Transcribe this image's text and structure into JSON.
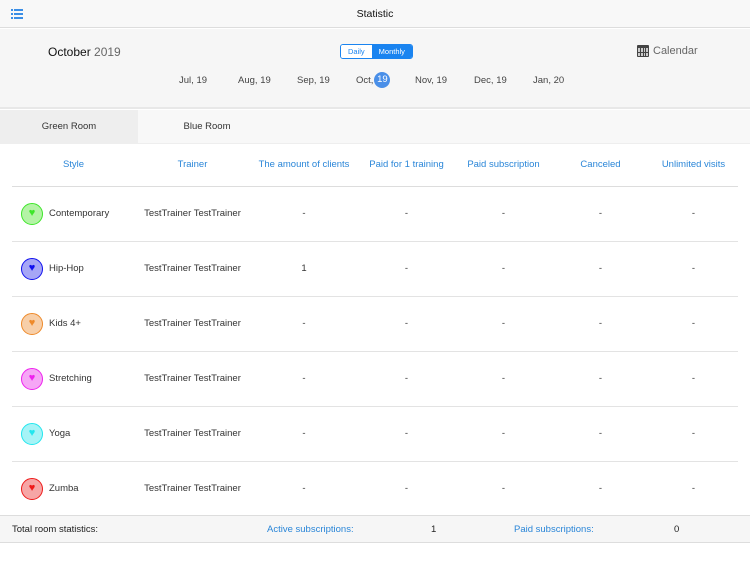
{
  "nav": {
    "title": "Statistic"
  },
  "header": {
    "month": "October",
    "year": "2019",
    "view_daily": "Daily",
    "view_monthly": "Monthly",
    "calendar_label": "Calendar",
    "months": [
      {
        "m": "Jul,",
        "d": "19"
      },
      {
        "m": "Aug,",
        "d": "19"
      },
      {
        "m": "Sep,",
        "d": "19"
      },
      {
        "m": "Oct,",
        "d": "19"
      },
      {
        "m": "Nov,",
        "d": "19"
      },
      {
        "m": "Dec,",
        "d": "19"
      },
      {
        "m": "Jan,",
        "d": "20"
      }
    ]
  },
  "tabs": [
    "Green Room",
    "Blue Room"
  ],
  "table": {
    "headers": [
      "Style",
      "Trainer",
      "The amount of clients",
      "Paid for 1 training",
      "Paid subscription",
      "Canceled",
      "Unlimited visits"
    ],
    "rows": [
      {
        "style": "Contemporary",
        "color": "#3ee62a",
        "bg": "#b4f3a6",
        "trainer": "TestTrainer TestTrainer",
        "cells": [
          "-",
          "-",
          "-",
          "-",
          "-"
        ]
      },
      {
        "style": "Hip-Hop",
        "color": "#1010ee",
        "bg": "#a6a6f6",
        "trainer": "TestTrainer TestTrainer",
        "cells": [
          "1",
          "-",
          "-",
          "-",
          "-"
        ]
      },
      {
        "style": "Kids 4+",
        "color": "#ee8a2a",
        "bg": "#f7cfa9",
        "trainer": "TestTrainer TestTrainer",
        "cells": [
          "-",
          "-",
          "-",
          "-",
          "-"
        ]
      },
      {
        "style": "Stretching",
        "color": "#ee22ee",
        "bg": "#f6a6f6",
        "trainer": "TestTrainer TestTrainer",
        "cells": [
          "-",
          "-",
          "-",
          "-",
          "-"
        ]
      },
      {
        "style": "Yoga",
        "color": "#22e6ee",
        "bg": "#a6f3f6",
        "trainer": "TestTrainer TestTrainer",
        "cells": [
          "-",
          "-",
          "-",
          "-",
          "-"
        ]
      },
      {
        "style": "Zumba",
        "color": "#ee1a1a",
        "bg": "#f6a6a6",
        "trainer": "TestTrainer TestTrainer",
        "cells": [
          "-",
          "-",
          "-",
          "-",
          "-"
        ]
      }
    ]
  },
  "footer": {
    "total_label": "Total room statistics:",
    "active_label": "Active subscriptions:",
    "active_value": "1",
    "paid_label": "Paid subscriptions:",
    "paid_value": "0"
  }
}
